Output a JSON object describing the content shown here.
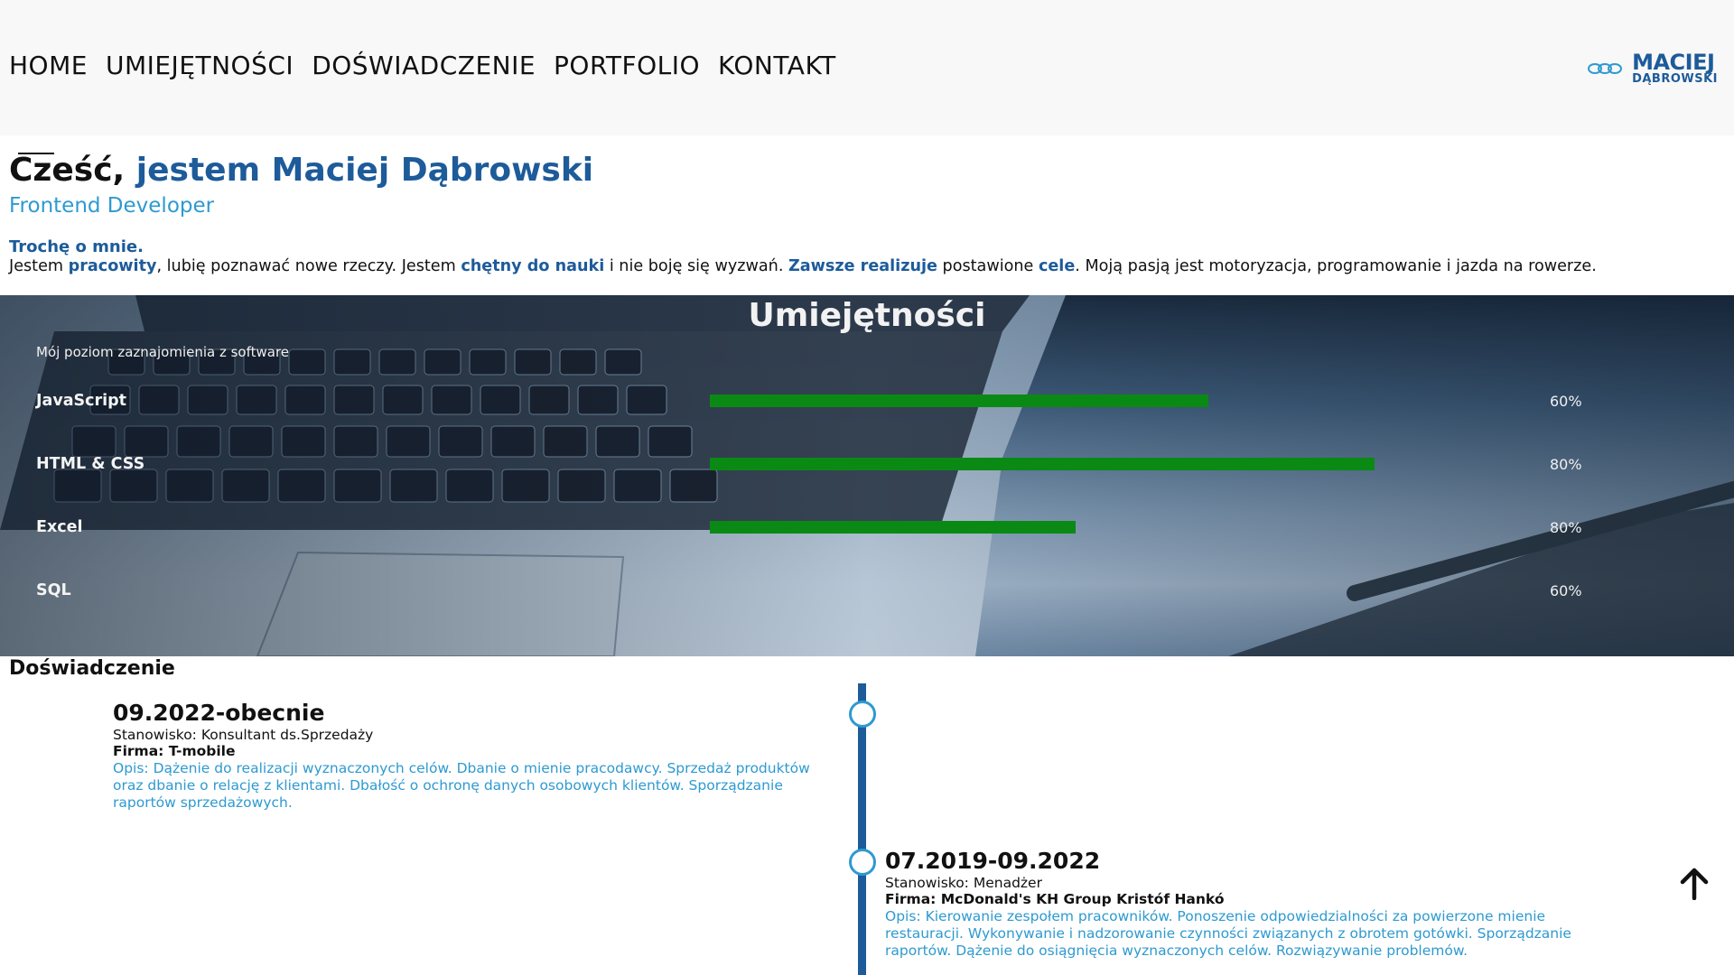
{
  "nav": {
    "items": [
      "HOME",
      "UMIEJĘTNOŚCI",
      "DOŚWIADCZENIE",
      "PORTFOLIO",
      "KONTAKT"
    ]
  },
  "logo": {
    "line1": "MACIEJ",
    "line2": "DĄBROWSKI",
    "icon": "chain-links-icon"
  },
  "hero": {
    "greeting": "Cześć,",
    "name": "jestem Maciej Dąbrowski",
    "role": "Frontend Developer"
  },
  "about": {
    "heading": "Trochę o mnie.",
    "t1": "Jestem ",
    "h1": "pracowity",
    "t2": ", lubię poznawać nowe rzeczy. Jestem ",
    "h2": "chętny do nauki",
    "t3": " i nie boję się wyzwań. ",
    "h3": "Zawsze realizuje",
    "t4": " postawione ",
    "h4": "cele",
    "t5": ". Moją pasją jest motoryzacja, programowanie i jazda na rowerze."
  },
  "skills": {
    "title": "Umiejętności",
    "intro": "Mój poziom zaznajomienia z software",
    "items": [
      {
        "name": "JavaScript",
        "percent": "60%",
        "level": 0.6
      },
      {
        "name": "HTML & CSS",
        "percent": "80%",
        "level": 0.8
      },
      {
        "name": "Excel",
        "percent": "80%",
        "level": 0.44
      },
      {
        "name": "SQL",
        "percent": "60%",
        "level": 0.0
      }
    ],
    "bar_color": "#0a8a14"
  },
  "experience": {
    "title": "Doświadczenie",
    "jobs": [
      {
        "date": "09.2022-obecnie",
        "position": "Stanowisko: Konsultant ds.Sprzedaży",
        "firm": "Firma: T-mobile",
        "desc": "Opis: Dążenie do realizacji wyznaczonych celów. Dbanie o mienie pracodawcy. Sprzedaż produktów oraz dbanie o relację z klientami. Dbałość o ochronę danych osobowych klientów. Sporządzanie raportów sprzedażowych."
      },
      {
        "date": "07.2019-09.2022",
        "position": "Stanowisko: Menadżer",
        "firm": "Firma: McDonald's KH Group Kristóf Hankó",
        "desc": "Opis: Kierowanie zespołem pracowników. Ponoszenie odpowiedzialności za powierzone mienie restauracji. Wykonywanie i nadzorowanie czynności związanych z obrotem gotówki. Sporządzanie raportów. Dążenie do osiągnięcia wyznaczonych celów. Rozwiązywanie problemów."
      }
    ]
  },
  "colors": {
    "brand_dark": "#1d5b9a",
    "brand_light": "#2e9ad0"
  },
  "scroll_top_icon": "arrow-up-icon"
}
